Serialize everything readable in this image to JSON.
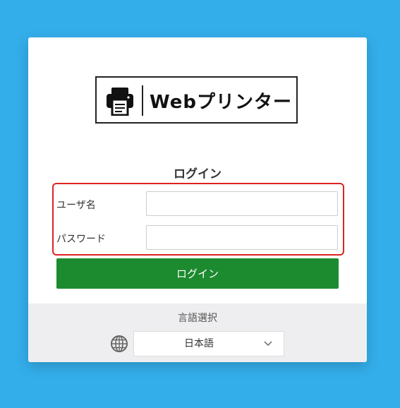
{
  "logo": {
    "text": "Webプリンター",
    "icon": "printer-icon"
  },
  "login": {
    "title": "ログイン",
    "username_label": "ユーザ名",
    "username_value": "",
    "password_label": "パスワード",
    "password_value": "",
    "button_label": "ログイン"
  },
  "language": {
    "title": "言語選択",
    "icon": "globe-icon",
    "selected": "日本語"
  },
  "colors": {
    "background": "#33aeea",
    "button": "#1c8a2e",
    "highlight": "#dd2222"
  }
}
